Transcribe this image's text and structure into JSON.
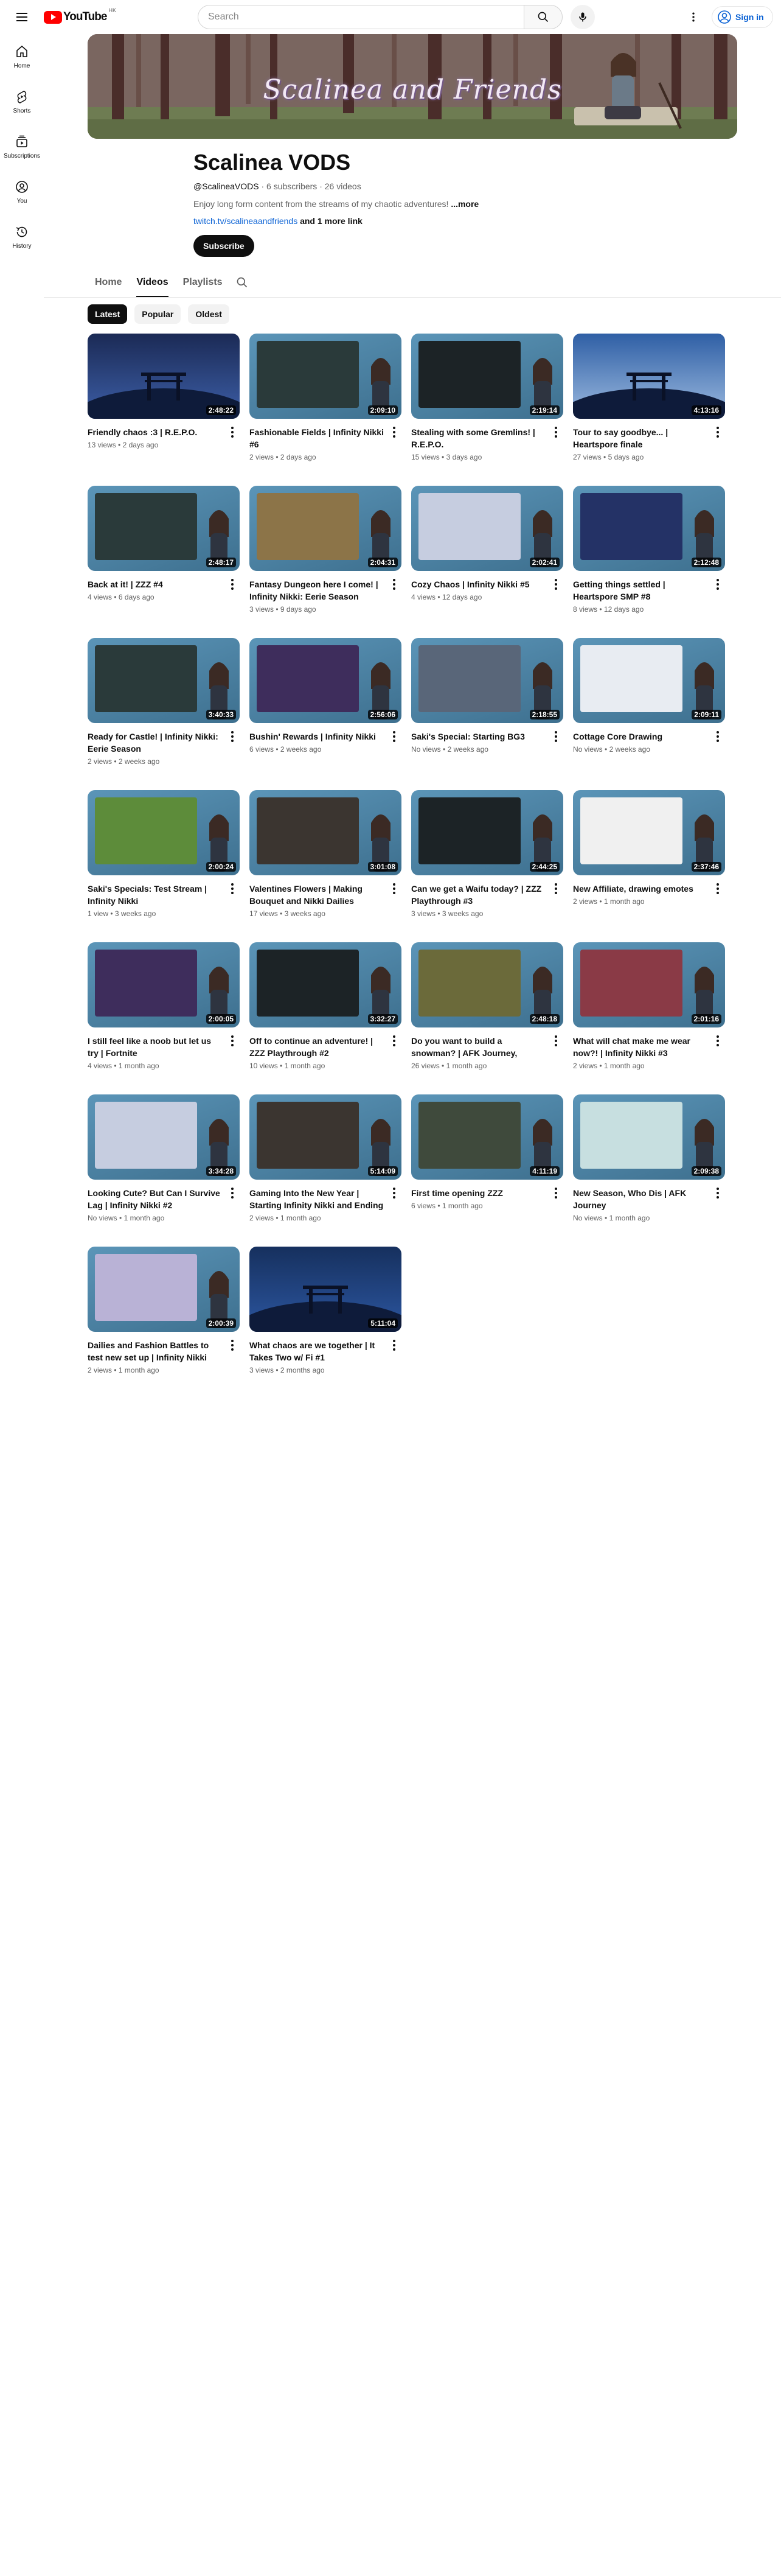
{
  "header": {
    "logo_text": "YouTube",
    "logo_region": "HK",
    "search_placeholder": "Search",
    "sign_in_label": "Sign in"
  },
  "nav": [
    {
      "label": "Home",
      "icon": "home-icon"
    },
    {
      "label": "Shorts",
      "icon": "shorts-icon"
    },
    {
      "label": "Subscriptions",
      "icon": "subscriptions-icon"
    },
    {
      "label": "You",
      "icon": "you-icon"
    },
    {
      "label": "History",
      "icon": "history-icon"
    }
  ],
  "banner": {
    "title": "Scalinea and Friends"
  },
  "channel": {
    "name": "Scalinea VODS",
    "handle": "@ScalineaVODS",
    "subscribers": "6 subscribers",
    "videos_count": "26 videos",
    "description": "Enjoy long form content from the streams of my chaotic adventures!",
    "more_label": "...more",
    "link": "twitch.tv/scalineaandfriends",
    "more_links": "and 1 more link",
    "subscribe_label": "Subscribe"
  },
  "tabs": [
    {
      "label": "Home",
      "active": false
    },
    {
      "label": "Videos",
      "active": true
    },
    {
      "label": "Playlists",
      "active": false
    }
  ],
  "chips": [
    {
      "label": "Latest",
      "active": true
    },
    {
      "label": "Popular",
      "active": false
    },
    {
      "label": "Oldest",
      "active": false
    }
  ],
  "videos": [
    {
      "title": "Friendly chaos :3 | R.E.P.O.",
      "views": "13 views",
      "age": "2 days ago",
      "duration": "2:48:22",
      "theme": "night"
    },
    {
      "title": "Fashionable Fields | Infinity Nikki #6",
      "views": "2 views",
      "age": "2 days ago",
      "duration": "2:09:10",
      "theme": "frame"
    },
    {
      "title": "Stealing with some Gremlins! | R.E.P.O.",
      "views": "15 views",
      "age": "3 days ago",
      "duration": "2:19:14",
      "theme": "dark"
    },
    {
      "title": "Tour to say goodbye... | Heartspore finale",
      "views": "27 views",
      "age": "5 days ago",
      "duration": "4:13:16",
      "theme": "sky"
    },
    {
      "title": "Back at it! | ZZZ #4",
      "views": "4 views",
      "age": "6 days ago",
      "duration": "2:48:17",
      "theme": "frame"
    },
    {
      "title": "Fantasy Dungeon here I come! | Infinity Nikki: Eerie Season",
      "views": "3 views",
      "age": "9 days ago",
      "duration": "2:04:31",
      "theme": "brown"
    },
    {
      "title": "Cozy Chaos | Infinity Nikki #5",
      "views": "4 views",
      "age": "12 days ago",
      "duration": "2:02:41",
      "theme": "pale"
    },
    {
      "title": "Getting things settled | Heartspore SMP #8",
      "views": "8 views",
      "age": "12 days ago",
      "duration": "2:12:48",
      "theme": "navy"
    },
    {
      "title": "Ready for Castle! | Infinity Nikki: Eerie Season",
      "views": "2 views",
      "age": "2 weeks ago",
      "duration": "3:40:33",
      "theme": "frame"
    },
    {
      "title": "Bushin' Rewards | Infinity Nikki",
      "views": "6 views",
      "age": "2 weeks ago",
      "duration": "2:56:06",
      "theme": "purple"
    },
    {
      "title": "Saki's Special: Starting BG3",
      "views": "No views",
      "age": "2 weeks ago",
      "duration": "2:18:55",
      "theme": "grey"
    },
    {
      "title": "Cottage Core Drawing",
      "views": "No views",
      "age": "2 weeks ago",
      "duration": "2:09:11",
      "theme": "draw"
    },
    {
      "title": "Saki's Specials: Test Stream | Infinity Nikki",
      "views": "1 view",
      "age": "3 weeks ago",
      "duration": "2:00:24",
      "theme": "green"
    },
    {
      "title": "Valentines Flowers | Making Bouquet and Nikki Dailies",
      "views": "17 views",
      "age": "3 weeks ago",
      "duration": "3:01:08",
      "theme": "cam"
    },
    {
      "title": "Can we get a Waifu today? | ZZZ Playthrough #3",
      "views": "3 views",
      "age": "3 weeks ago",
      "duration": "2:44:25",
      "theme": "dark"
    },
    {
      "title": "New Affiliate, drawing emotes",
      "views": "2 views",
      "age": "1 month ago",
      "duration": "2:37:46",
      "theme": "sketch"
    },
    {
      "title": "I still feel like a noob but let us try | Fortnite",
      "views": "4 views",
      "age": "1 month ago",
      "duration": "2:00:05",
      "theme": "purple"
    },
    {
      "title": "Off to continue an adventure! | ZZZ Playthrough #2",
      "views": "10 views",
      "age": "1 month ago",
      "duration": "3:32:27",
      "theme": "dark"
    },
    {
      "title": "Do you want to build a snowman? | AFK Journey, Chains of Eternity",
      "views": "26 views",
      "age": "1 month ago",
      "duration": "2:48:18",
      "theme": "gold"
    },
    {
      "title": "What will chat make me wear now?! | Infinity Nikki #3",
      "views": "2 views",
      "age": "1 month ago",
      "duration": "2:01:16",
      "theme": "red"
    },
    {
      "title": "Looking Cute? But Can I Survive Lag | Infinity Nikki #2",
      "views": "No views",
      "age": "1 month ago",
      "duration": "3:34:28",
      "theme": "pale"
    },
    {
      "title": "Gaming Into the New Year | Starting Infinity Nikki and Ending With Som...",
      "views": "2 views",
      "age": "1 month ago",
      "duration": "5:14:09",
      "theme": "cam"
    },
    {
      "title": "First time opening ZZZ",
      "views": "6 views",
      "age": "1 month ago",
      "duration": "4:11:19",
      "theme": "tv"
    },
    {
      "title": "New Season, Who Dis | AFK Journey",
      "views": "No views",
      "age": "1 month ago",
      "duration": "2:09:38",
      "theme": "teal"
    },
    {
      "title": "Dailies and Fashion Battles to test new set up | Infinity Nikki",
      "views": "2 views",
      "age": "1 month ago",
      "duration": "2:00:39",
      "theme": "lilac"
    },
    {
      "title": "What chaos are we together | It Takes Two w/ Fi #1",
      "views": "3 views",
      "age": "2 months ago",
      "duration": "5:11:04",
      "theme": "nightblue"
    }
  ]
}
